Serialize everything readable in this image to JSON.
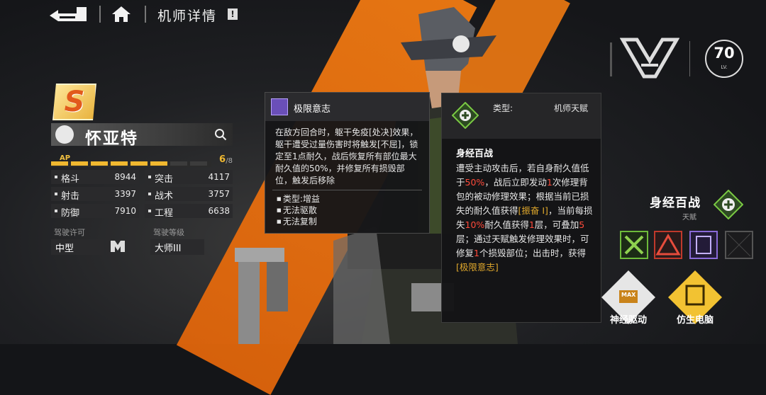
{
  "header": {
    "title": "机师详情",
    "info_mark": "!"
  },
  "pilot": {
    "rank": "S",
    "name": "怀亚特",
    "ap": {
      "label": "AP",
      "current": "6",
      "max": "/8",
      "filled": 6,
      "total": 8
    },
    "stats": [
      {
        "label": "格斗",
        "value": "8944"
      },
      {
        "label": "突击",
        "value": "4117"
      },
      {
        "label": "射击",
        "value": "3397"
      },
      {
        "label": "战术",
        "value": "3757"
      },
      {
        "label": "防御",
        "value": "7910"
      },
      {
        "label": "工程",
        "value": "6638"
      }
    ],
    "license_label": "驾驶许可",
    "license_value": "中型",
    "grade_label": "驾驶等级",
    "grade_value": "大师III"
  },
  "tooltip_skill": {
    "title": "极限意志",
    "description": "在敌方回合时，躯干免疫[处决]效果，躯干遭受过量伤害时将触发[不屈]，锁定至1点耐久，战后恢复所有部位最大耐久值的50%，并修复所有损毁部位，触发后移除",
    "list": [
      "类型:增益",
      "无法驱散",
      "无法复制"
    ]
  },
  "tooltip_talent": {
    "type_label": "类型:",
    "type_value": "机师天赋",
    "name": "身经百战",
    "body": {
      "p1": "遭受主动攻击后，若自身耐久值低于",
      "p1_hl": "50%",
      "p2": "，战后立即发动",
      "p2_hl": "1",
      "p3": "次修理背包的被动修理效果；根据当前已损失的耐久值获得",
      "tag1": "[振奋 I]",
      "p4": "，当前每损失",
      "p4_hl": "10%",
      "p5": "耐久值获得",
      "p5_hl": "1",
      "p6": "层，可叠加",
      "p6_hl": "5",
      "p7": "层；通过天赋触发修理效果时，可修复",
      "p7_hl": "1",
      "p8": "个损毁部位；出击时，获得",
      "tag2": "[极限意志]"
    }
  },
  "level": {
    "value": "70",
    "unit": "LV."
  },
  "talent_panel": {
    "name": "身经百战",
    "sub": "天赋"
  },
  "modules": [
    {
      "label": "神经驱动",
      "badge": "MAX"
    },
    {
      "label": "仿生电脑"
    }
  ],
  "colors": {
    "accent": "#f07a12",
    "highlight": "#ff4a3a",
    "tag": "#e0a82c",
    "ap": "#f0b830"
  }
}
